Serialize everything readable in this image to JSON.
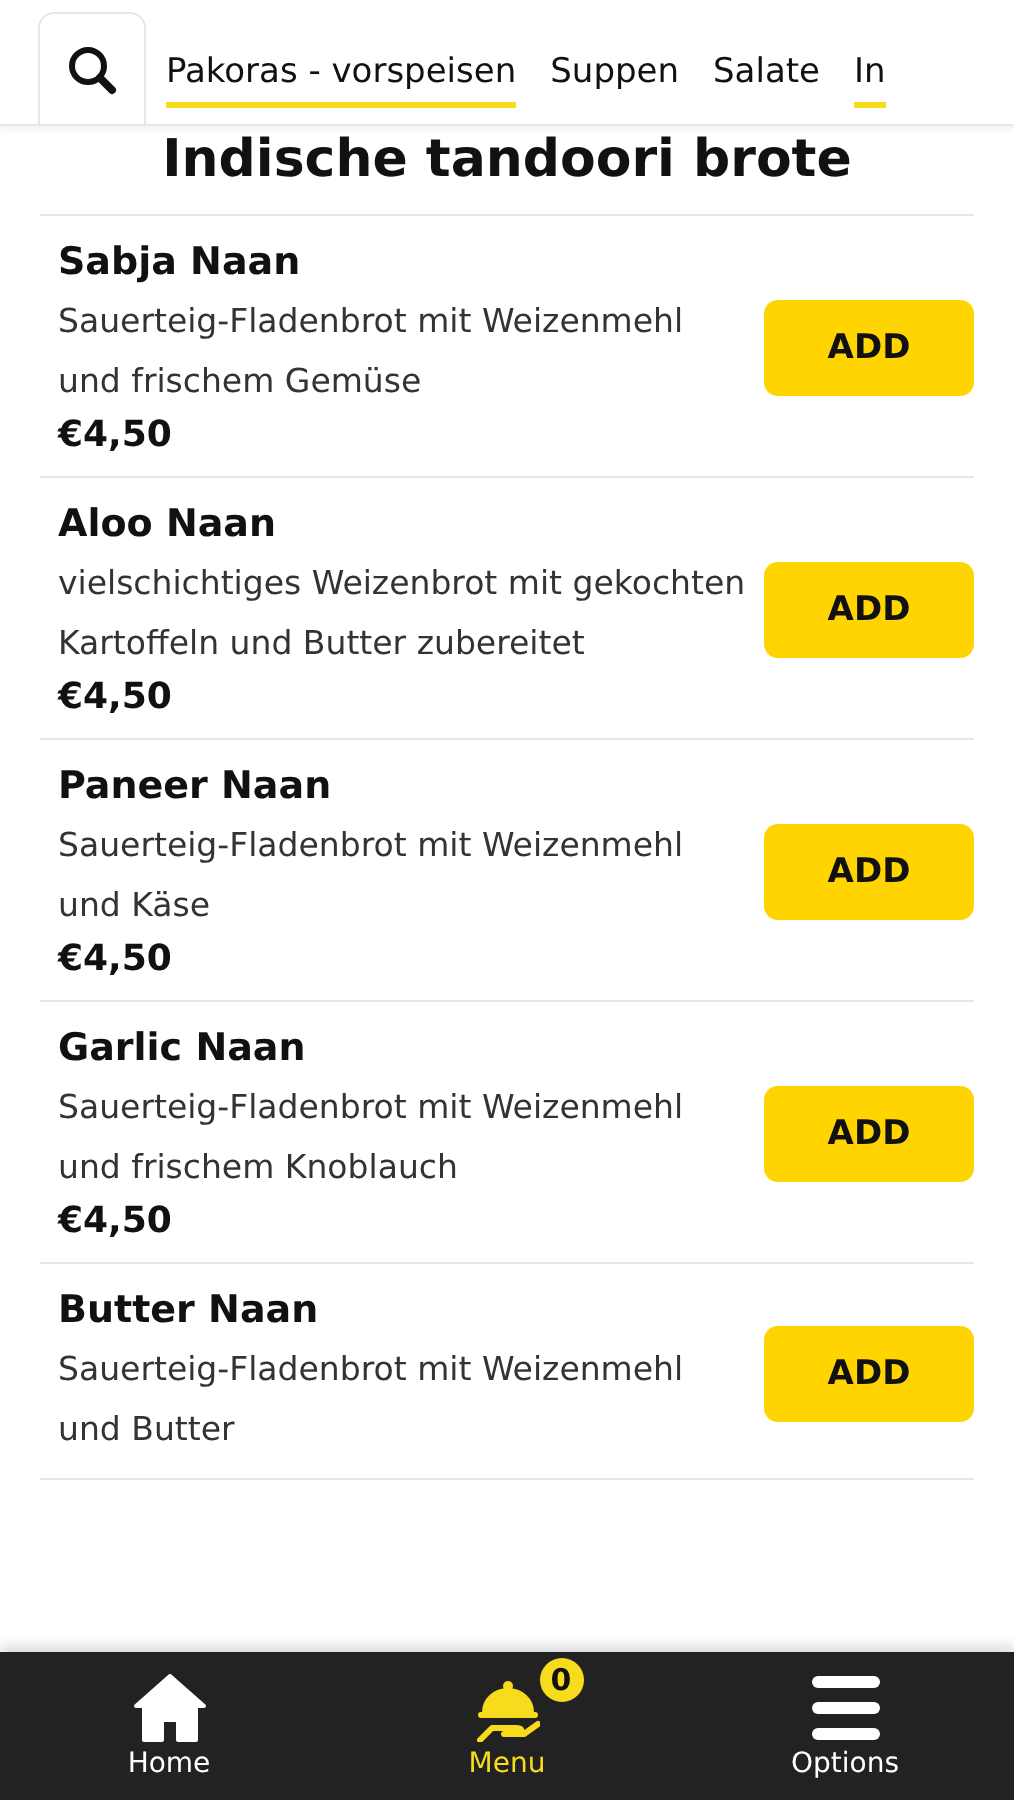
{
  "tabs": [
    {
      "label": "Pakoras - vorspeisen",
      "selected": true
    },
    {
      "label": "Suppen",
      "selected": false
    },
    {
      "label": "Salate",
      "selected": false
    },
    {
      "label": "In",
      "selected": true
    }
  ],
  "section_title": "Indische tandoori brote",
  "items": [
    {
      "name": "Sabja Naan",
      "description": "Sauerteig-Fladenbrot mit Weizenmehl und frischem Gemüse",
      "price": "€4,50",
      "button": "ADD"
    },
    {
      "name": "Aloo Naan",
      "description": "vielschichtiges Weizenbrot mit gekochten Kartoffeln und Butter zubereitet",
      "price": "€4,50",
      "button": "ADD"
    },
    {
      "name": "Paneer Naan",
      "description": "Sauerteig-Fladenbrot mit Weizenmehl und Käse",
      "price": "€4,50",
      "button": "ADD"
    },
    {
      "name": "Garlic Naan",
      "description": "Sauerteig-Fladenbrot mit Weizenmehl und frischem Knoblauch",
      "price": "€4,50",
      "button": "ADD"
    },
    {
      "name": "Butter Naan",
      "description": "Sauerteig-Fladenbrot mit Weizenmehl und Butter",
      "button": "ADD"
    }
  ],
  "nav": [
    {
      "kind": "home",
      "label": "Home",
      "selected": false
    },
    {
      "kind": "menu",
      "label": "Menu",
      "selected": true,
      "badge": "0"
    },
    {
      "kind": "options",
      "label": "Options",
      "selected": false
    }
  ]
}
